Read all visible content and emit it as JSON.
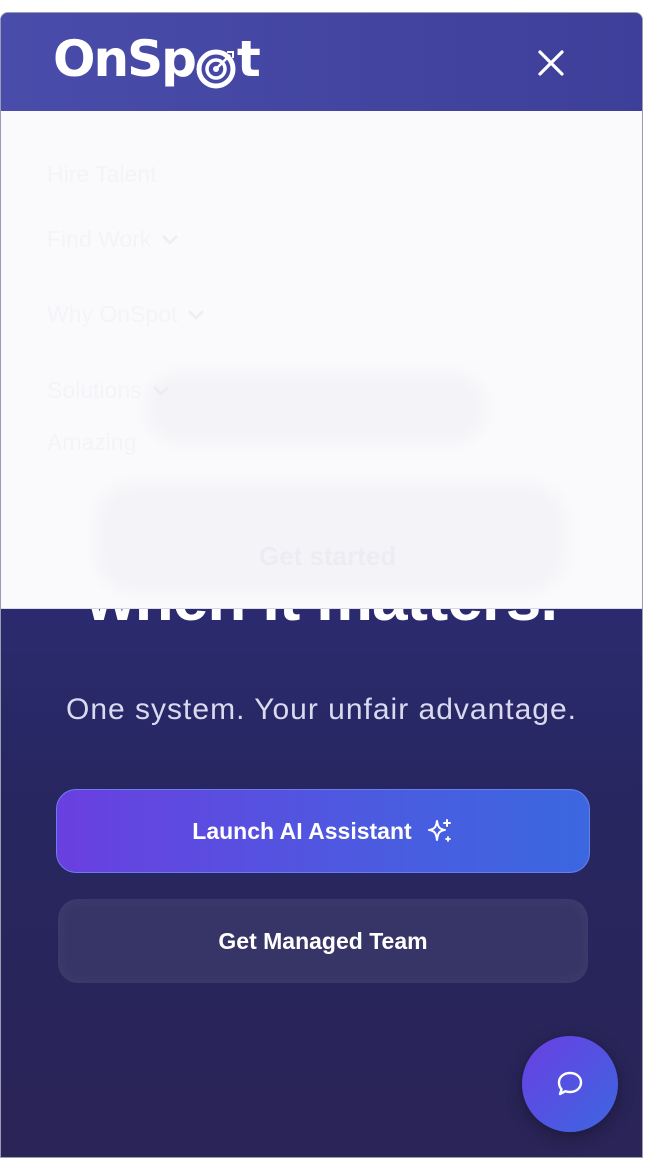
{
  "header": {
    "logo_text_left": "On",
    "logo_text_mid": "Sp",
    "logo_text_right": "t",
    "close_icon": "close-icon"
  },
  "menu": {
    "items": [
      {
        "label": "Hire Talent",
        "has_chevron": false
      },
      {
        "label": "Find Work",
        "has_chevron": true
      },
      {
        "label": "Why OnSpot",
        "has_chevron": true
      },
      {
        "label": "Solutions",
        "has_chevron": true
      }
    ],
    "overlapped_text_1": "Amazing",
    "overlapped_text_2": "Get started"
  },
  "hero": {
    "headline_tail": "when it matters.",
    "subtitle": "One system. Your unfair advantage."
  },
  "actions": {
    "primary_label": "Launch AI Assistant",
    "primary_icon": "sparkles-icon",
    "secondary_label": "Get Managed Team"
  },
  "chat": {
    "icon": "chat-bubble-icon"
  },
  "colors": {
    "background_top": "#3c3d94",
    "background_bottom": "#2a2457",
    "primary_gradient_start": "#6a3fe0",
    "primary_gradient_end": "#3b67e0",
    "menu_panel": "#fafafc"
  }
}
